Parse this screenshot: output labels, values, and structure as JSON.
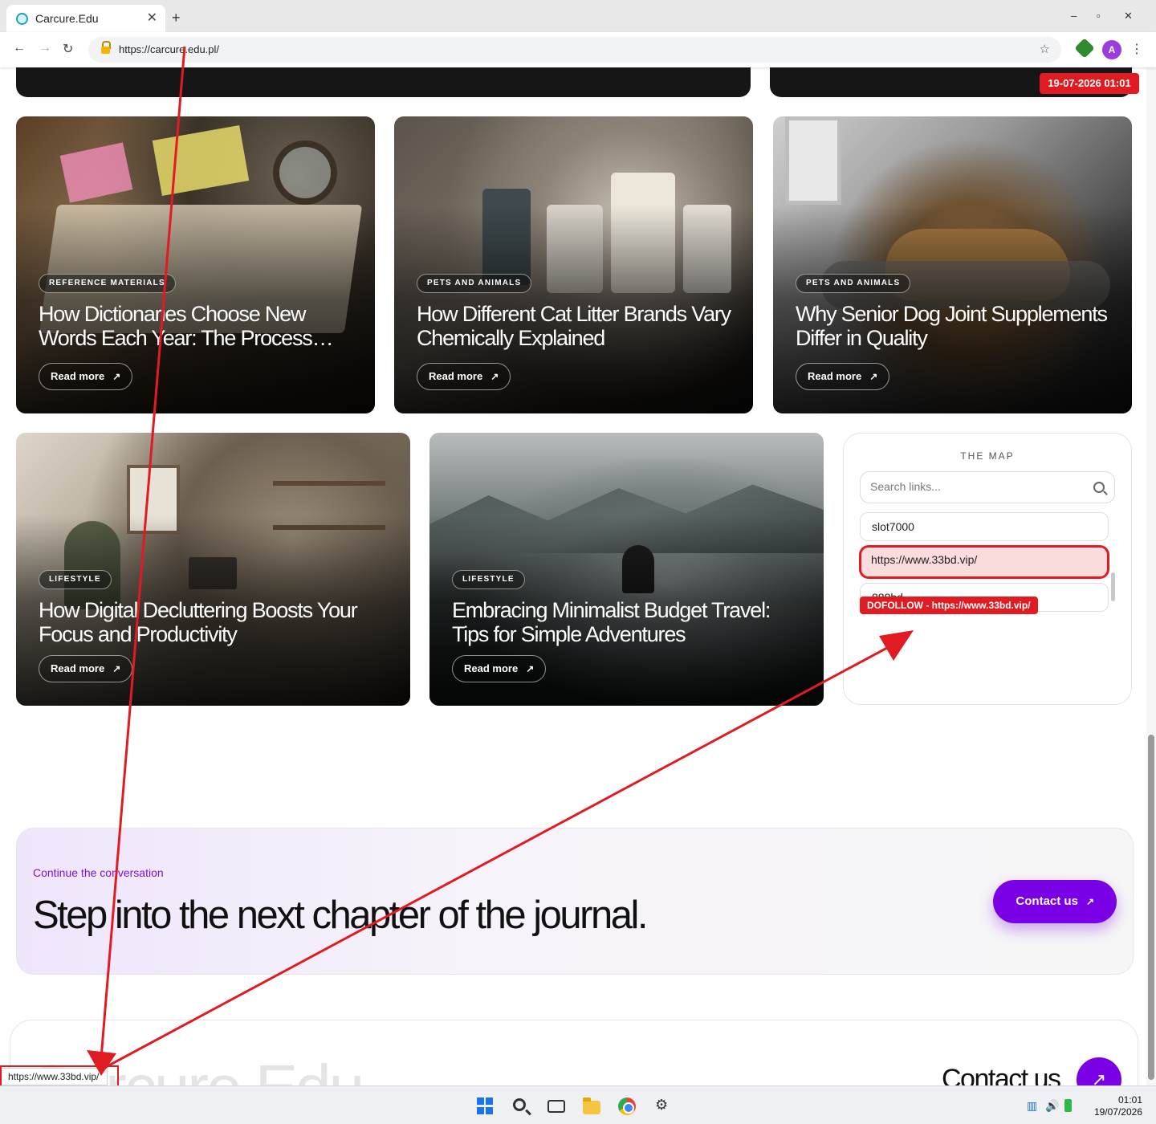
{
  "browser": {
    "tab_title": "Carcure.Edu",
    "new_tab_label": "+",
    "close_tab_label": "✕",
    "minimize_label": "–",
    "maximize_label": "▫",
    "close_window_label": "✕",
    "back_label": "←",
    "forward_label": "→",
    "reload_label": "↻",
    "url": "https://carcure.edu.pl/",
    "bookmark_label": "☆",
    "profile_initial": "A",
    "menu_label": "⋮",
    "status_url": "https://www.33bd.vip/"
  },
  "timestamp_badge": "19-07-2026 01:01",
  "articles_row1": [
    {
      "category": "REFERENCE MATERIALS",
      "title": "How Dictionaries Choose New Words Each Year: The Process…",
      "read_more": "Read more",
      "arrow": "↗"
    },
    {
      "category": "PETS AND ANIMALS",
      "title": "How Different Cat Litter Brands Vary Chemically Explained",
      "read_more": "Read more",
      "arrow": "↗"
    },
    {
      "category": "PETS AND ANIMALS",
      "title": "Why Senior Dog Joint Supplements Differ in Quality",
      "read_more": "Read more",
      "arrow": "↗"
    }
  ],
  "articles_row2": [
    {
      "category": "LIFESTYLE",
      "title": "How Digital Decluttering Boosts Your Focus and Productivity",
      "read_more": "Read more",
      "arrow": "↗"
    },
    {
      "category": "LIFESTYLE",
      "title": "Embracing Minimalist Budget Travel: Tips for Simple Adventures",
      "read_more": "Read more",
      "arrow": "↗"
    }
  ],
  "map": {
    "title": "THE MAP",
    "search_placeholder": "Search links...",
    "links": [
      "slot7000",
      "https://www.33bd.vip/",
      "888bd"
    ],
    "tooltip": "DOFOLLOW - https://www.33bd.vip/"
  },
  "cta": {
    "kicker": "Continue the conversation",
    "heading": "Step into the next chapter of the journal.",
    "button": "Contact us",
    "arrow": "↗"
  },
  "footer": {
    "brand": "Carcure.Edu",
    "contact": "Contact us",
    "arrow": "↗"
  },
  "taskbar": {
    "time": "01:01",
    "date": "19/07/2026"
  },
  "colors": {
    "accent_purple": "#7a00e6",
    "annotation_red": "#e11b22"
  },
  "icons": [
    "search-icon",
    "lock-icon",
    "star-icon",
    "extension-icon",
    "windows-icon",
    "folder-icon",
    "chrome-icon",
    "gear-icon"
  ]
}
